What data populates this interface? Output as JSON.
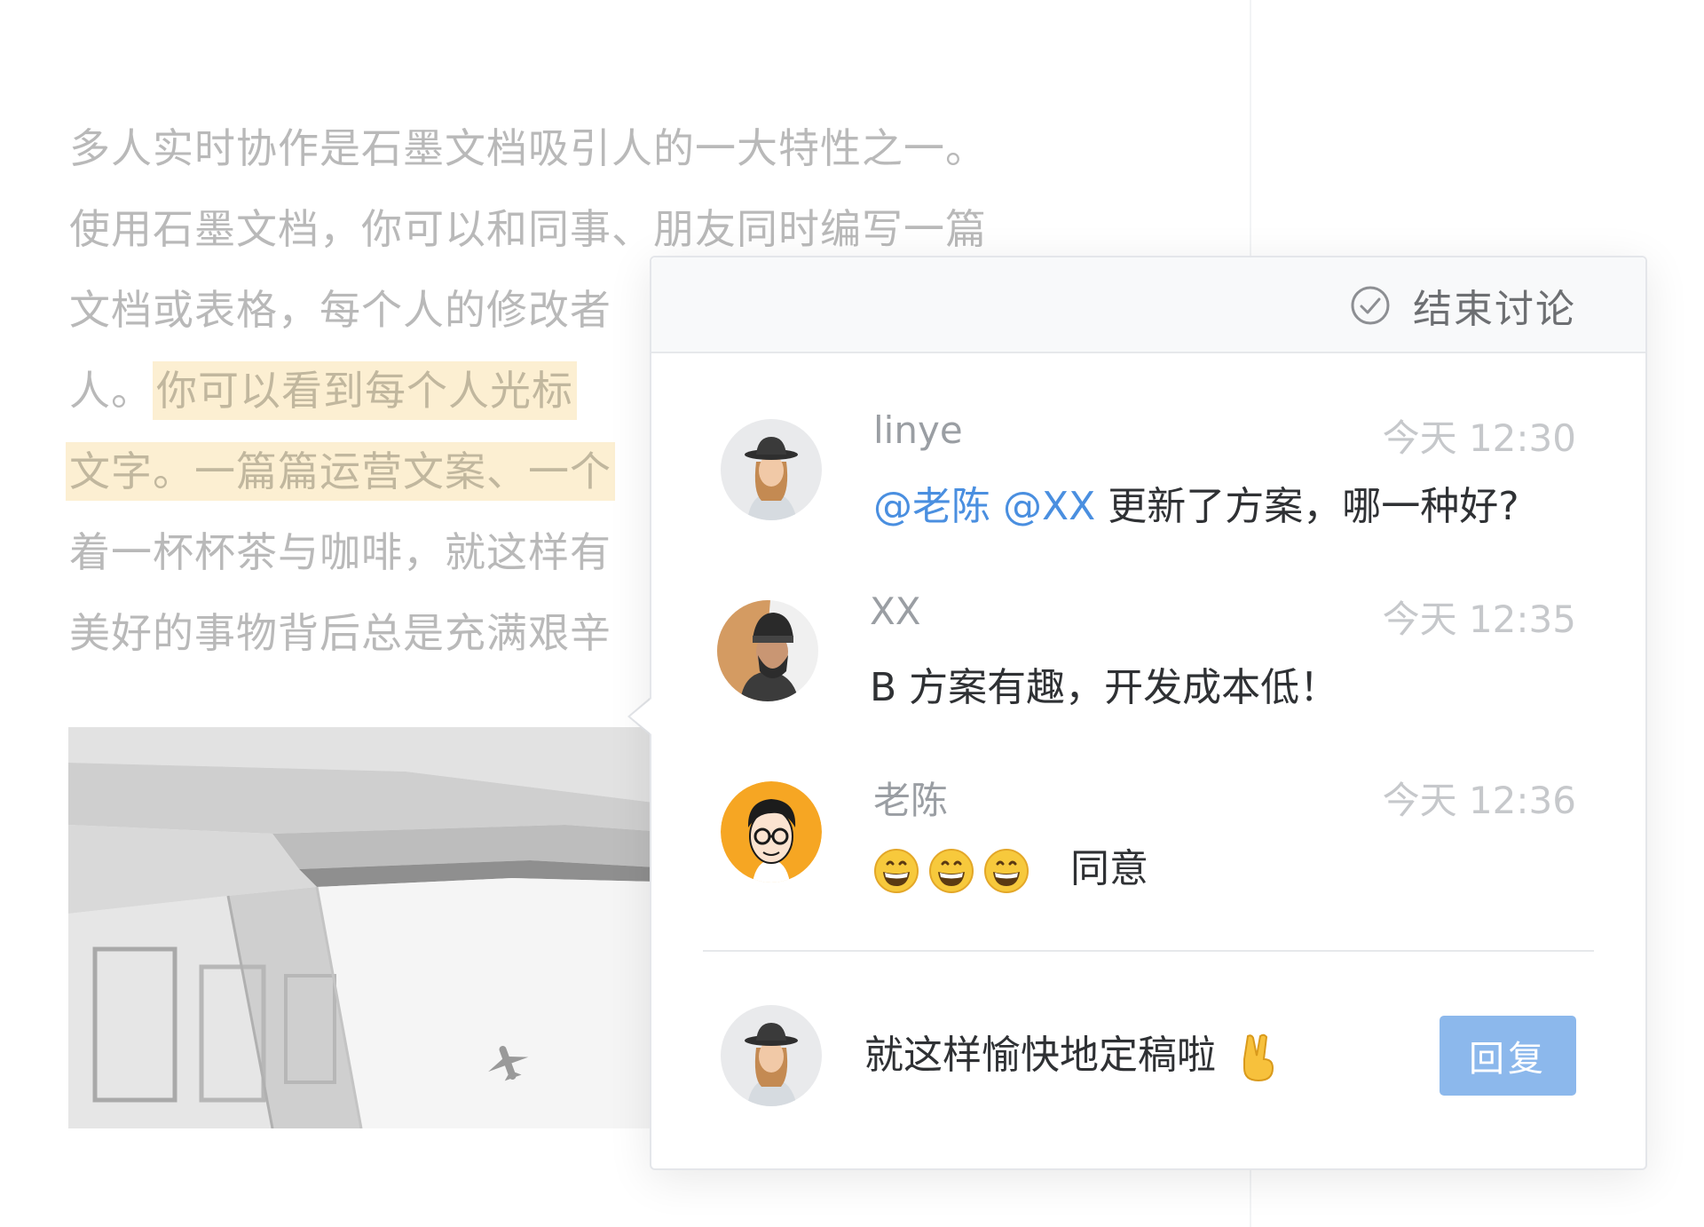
{
  "document": {
    "lines": [
      {
        "plain": "多人实时协作是石墨文档吸引人的一大特性之一。",
        "highlight": ""
      },
      {
        "plain": "使用石墨文档，你可以和同事、朋友同时编写一篇",
        "highlight": ""
      },
      {
        "plain": "文档或表格，每个人的修改者",
        "highlight": ""
      },
      {
        "plain": "人。",
        "highlight": "你可以看到每个人光标"
      },
      {
        "plain": "",
        "highlight": "文字。一篇篇运营文案、一个"
      },
      {
        "plain": "着一杯杯茶与咖啡，就这样有",
        "highlight": ""
      },
      {
        "plain": "美好的事物背后总是充满艰辛",
        "highlight": ""
      }
    ],
    "highlight_color": "#fcefd2"
  },
  "discussion": {
    "end_label": "结束讨论",
    "end_icon": "check-circle-icon",
    "comments": [
      {
        "author": "linye",
        "time": "今天 12:30",
        "mentions": [
          "@老陈",
          "@XX"
        ],
        "text": "更新了方案，哪一种好?",
        "avatar": "avatar-linye"
      },
      {
        "author": "XX",
        "time": "今天 12:35",
        "mentions": [],
        "text": "B 方案有趣，开发成本低！",
        "avatar": "avatar-xx"
      },
      {
        "author": "老陈",
        "time": "今天 12:36",
        "mentions": [],
        "emojis": [
          "grinning-face",
          "grinning-face",
          "grinning-face"
        ],
        "text": "同意",
        "avatar": "avatar-laochen"
      }
    ],
    "reply": {
      "value": "就这样愉快地定稿啦",
      "emoji": "victory-hand",
      "button_label": "回复",
      "avatar": "avatar-linye"
    }
  },
  "colors": {
    "mention": "#4a8fe0",
    "reply_button": "#8cb8ec",
    "laochen_avatar_bg": "#f6a623"
  }
}
